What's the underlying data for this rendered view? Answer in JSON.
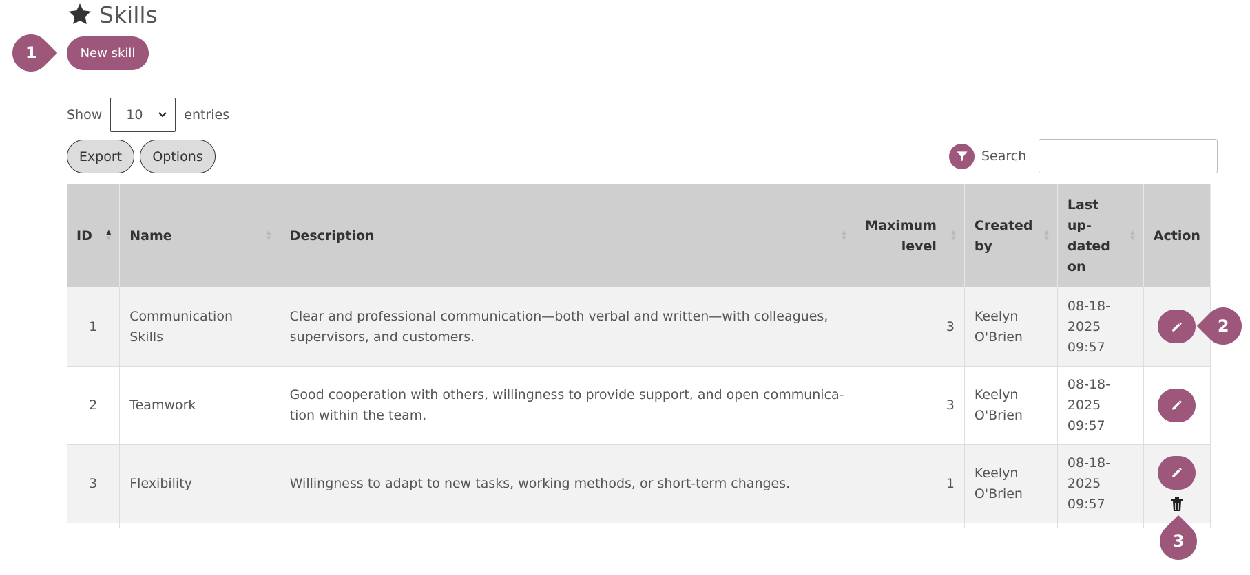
{
  "page": {
    "title": "Skills"
  },
  "toolbar": {
    "new_skill_label": "New skill"
  },
  "callouts": [
    "1",
    "2",
    "3"
  ],
  "entries": {
    "show_label": "Show",
    "value": "10",
    "suffix": "entries"
  },
  "buttons": {
    "export": "Export",
    "options": "Options"
  },
  "search": {
    "label": "Search",
    "value": ""
  },
  "table": {
    "headers": {
      "id": "ID",
      "name": "Name",
      "description": "Description",
      "max_level": "Maximum level",
      "created_by": "Created by",
      "updated": "Last up-dated on",
      "action": "Action"
    },
    "rows": [
      {
        "id": "1",
        "name": "Communication Skills",
        "description": "Clear and professional communication—both verbal and written—with colleagues, supervisors, and customers.",
        "max_level": "3",
        "created_by": "Keelyn O'Brien",
        "updated": "08-18-2025 09:57"
      },
      {
        "id": "2",
        "name": "Teamwork",
        "description": "Good cooperation with others, willingness to provide support, and open communica-tion within the team.",
        "max_level": "3",
        "created_by": "Keelyn O'Brien",
        "updated": "08-18-2025 09:57"
      },
      {
        "id": "3",
        "name": "Flexibility",
        "description": "Willingness to adapt to new tasks, working methods, or short-term changes.",
        "max_level": "1",
        "created_by": "Keelyn O'Brien",
        "updated": "08-18-2025 09:57"
      }
    ]
  },
  "colors": {
    "accent": "#9c577b",
    "header_bg": "#cfcfcf",
    "row_alt": "#f2f2f2"
  },
  "icons": [
    "star-icon",
    "filter-icon",
    "pencil-icon",
    "trash-icon",
    "chevron-down-icon"
  ]
}
